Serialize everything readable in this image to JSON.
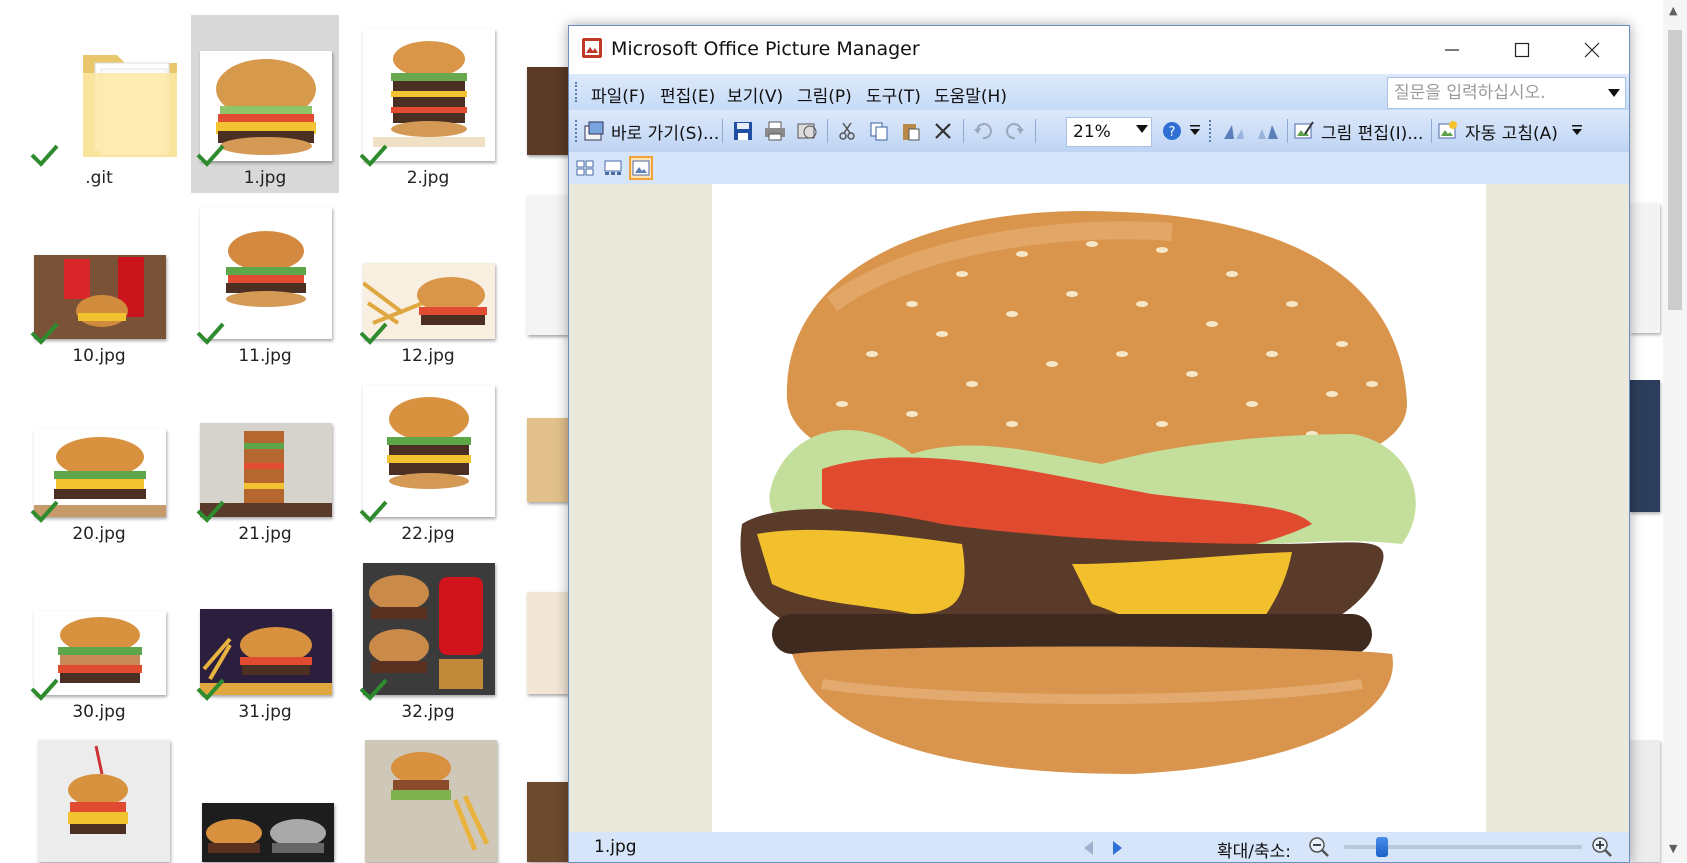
{
  "explorer": {
    "files": [
      {
        "name": ".git",
        "kind": "folder",
        "synced": true
      },
      {
        "name": "1.jpg",
        "selected": true,
        "synced": true
      },
      {
        "name": "2.jpg",
        "synced": true
      },
      {
        "name": "10.jpg",
        "synced": true
      },
      {
        "name": "11.jpg",
        "synced": true
      },
      {
        "name": "12.jpg",
        "synced": true
      },
      {
        "name": "20.jpg",
        "synced": true
      },
      {
        "name": "21.jpg",
        "synced": true
      },
      {
        "name": "22.jpg",
        "synced": true
      },
      {
        "name": "30.jpg",
        "synced": true
      },
      {
        "name": "31.jpg",
        "synced": true
      },
      {
        "name": "32.jpg",
        "synced": true
      }
    ],
    "sync_check_color": "#2e8b2e",
    "selection_color": "#d9d9d9"
  },
  "window": {
    "title": "Microsoft Office Picture Manager",
    "app_icon": "picture-manager-icon",
    "controls": [
      "minimize-icon",
      "maximize-icon",
      "close-icon"
    ]
  },
  "menu": {
    "items": [
      "파일(F)",
      "편집(E)",
      "보기(V)",
      "그림(P)",
      "도구(T)",
      "도움말(H)"
    ],
    "help_placeholder": "질문을 입력하십시오."
  },
  "toolbar": {
    "shortcuts_label": "바로 가기(S)...",
    "zoom_value": "21%",
    "edit_picture_label": "그림 편집(I)...",
    "auto_correct_label": "자동 고침(A)",
    "icons": [
      "save-icon",
      "print-icon",
      "send-email-icon",
      "cut-icon",
      "copy-icon",
      "paste-icon",
      "delete-icon",
      "undo-icon",
      "redo-icon",
      "help-icon",
      "rotate-left-icon",
      "rotate-right-icon"
    ]
  },
  "view_modes": [
    "thumbnail-view-icon",
    "filmstrip-view-icon",
    "single-picture-view-icon"
  ],
  "status": {
    "filename": "1.jpg",
    "zoom_label": "확대/축소:",
    "zoom_level": 0.21
  },
  "colors": {
    "toolbar_bg": "#c6dbf7",
    "canvas_bg": "#ebe9dc",
    "accent": "#f2a23a"
  }
}
